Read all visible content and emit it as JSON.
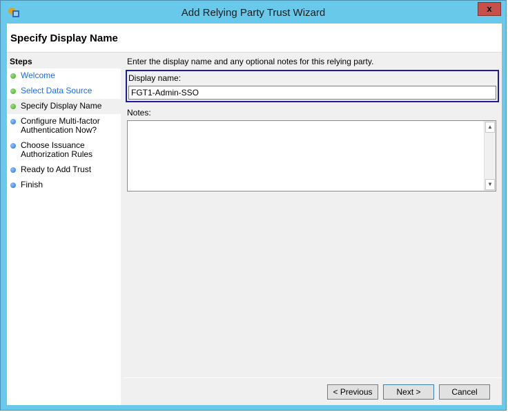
{
  "window": {
    "title": "Add Relying Party Trust Wizard",
    "close": "x"
  },
  "header": {
    "title": "Specify Display Name"
  },
  "steps": {
    "heading": "Steps",
    "items": [
      {
        "label": "Welcome",
        "state": "done"
      },
      {
        "label": "Select Data Source",
        "state": "done"
      },
      {
        "label": "Specify Display Name",
        "state": "current"
      },
      {
        "label": "Configure Multi-factor Authentication Now?",
        "state": "pending"
      },
      {
        "label": "Choose Issuance Authorization Rules",
        "state": "pending"
      },
      {
        "label": "Ready to Add Trust",
        "state": "pending"
      },
      {
        "label": "Finish",
        "state": "pending"
      }
    ]
  },
  "main": {
    "intro": "Enter the display name and any optional notes for this relying party.",
    "display_name_label": "Display name:",
    "display_name_value": "FGT1-Admin-SSO",
    "notes_label": "Notes:",
    "notes_value": ""
  },
  "buttons": {
    "previous": "< Previous",
    "next": "Next >",
    "cancel": "Cancel"
  }
}
